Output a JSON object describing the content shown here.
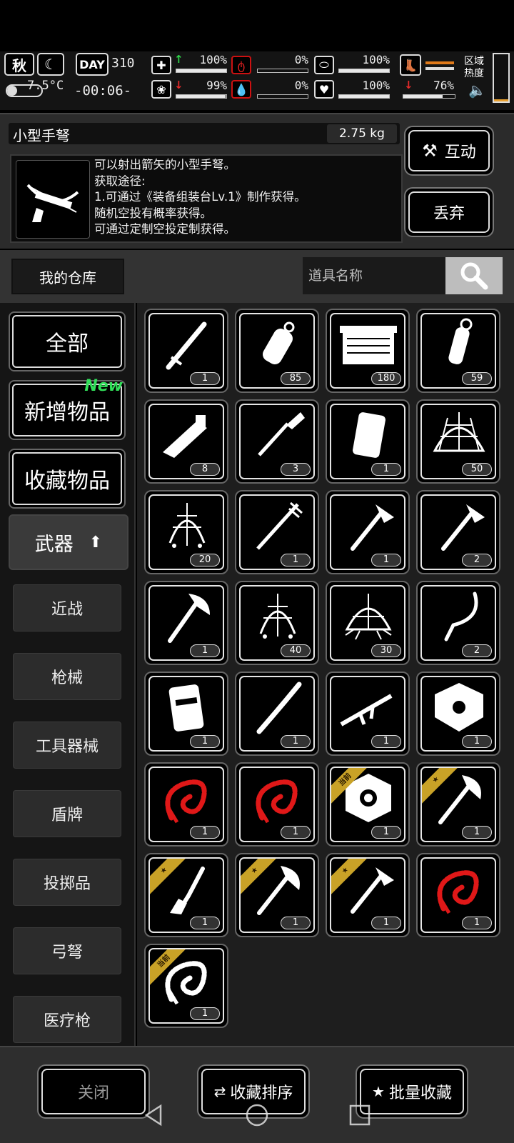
{
  "hud": {
    "season": "秋",
    "temperature": "7.5°C",
    "day_label": "DAY",
    "day_number": "310",
    "clock": "-00:06-",
    "stats": [
      {
        "icon": "medkit-icon",
        "trend": "up",
        "value": "100%",
        "level": 1.0
      },
      {
        "icon": "stomach-icon",
        "trend": "none",
        "value": "0%",
        "level": 0.0
      },
      {
        "icon": "capsule-icon",
        "trend": "none",
        "value": "100%",
        "level": 1.0
      },
      {
        "icon": "brain-icon",
        "trend": "down",
        "value": "99%",
        "level": 0.99
      },
      {
        "icon": "blood-drop-icon",
        "trend": "none",
        "value": "0%",
        "level": 0.0
      },
      {
        "icon": "heart-icon",
        "trend": "none",
        "value": "100%",
        "level": 1.0
      }
    ],
    "stamina": {
      "icon": "boot-icon",
      "trend": "down",
      "value": "76%",
      "level": 0.76
    },
    "zone_label": "区域\n热度",
    "zone_heat_level": 0.05
  },
  "detail": {
    "item_name": "小型手弩",
    "weight": "2.75 kg",
    "description": [
      "可以射出箭矢的小型手弩。",
      "获取途径:",
      "1.可通过《装备组装台Lv.1》制作获得。",
      "随机空投有概率获得。",
      "可通过定制空投定制获得。"
    ],
    "interact_label": "互动",
    "discard_label": "丢弃"
  },
  "warehouse": {
    "tab_label": "我的仓库",
    "search_placeholder": "道具名称"
  },
  "categories": {
    "all": "全部",
    "new_items": "新增物品",
    "new_badge": "New",
    "favorites": "收藏物品",
    "weapons": "武器",
    "subcategories": [
      "近战",
      "枪械",
      "工具器械",
      "盾牌",
      "投掷品",
      "弓弩",
      "医疗枪"
    ]
  },
  "items": [
    {
      "icon": "baton-icon",
      "count": "1"
    },
    {
      "icon": "frag-grenade-icon",
      "count": "85"
    },
    {
      "icon": "ammo-crate-icon",
      "count": "180"
    },
    {
      "icon": "stun-grenade-icon",
      "count": "59"
    },
    {
      "icon": "multi-tool-icon",
      "count": "8"
    },
    {
      "icon": "shovel-icon",
      "count": "3"
    },
    {
      "icon": "armor-plate-icon",
      "count": "1"
    },
    {
      "icon": "net-dome-icon",
      "count": "50"
    },
    {
      "icon": "throw-net-icon",
      "count": "20"
    },
    {
      "icon": "spiked-staff-icon",
      "count": "1"
    },
    {
      "icon": "hatchet-icon",
      "count": "1"
    },
    {
      "icon": "hatchet-icon",
      "count": "2"
    },
    {
      "icon": "battle-axe-icon",
      "count": "1"
    },
    {
      "icon": "throw-net-icon",
      "count": "40"
    },
    {
      "icon": "spider-net-icon",
      "count": "30"
    },
    {
      "icon": "sickle-icon",
      "count": "2"
    },
    {
      "icon": "riot-shield-icon",
      "count": "1"
    },
    {
      "icon": "wooden-club-icon",
      "count": "1"
    },
    {
      "icon": "assault-rifle-icon",
      "count": "1"
    },
    {
      "icon": "round-shield-icon",
      "count": "1"
    },
    {
      "icon": "red-chain-whip-icon",
      "count": "1"
    },
    {
      "icon": "red-chain-whip-icon",
      "count": "1"
    },
    {
      "icon": "hex-shield-icon",
      "count": "1",
      "ribbon": "当前"
    },
    {
      "icon": "axe-icon",
      "count": "1",
      "ribbon": "★"
    },
    {
      "icon": "chisel-icon",
      "count": "1",
      "ribbon": "★"
    },
    {
      "icon": "axe-icon",
      "count": "1",
      "ribbon": "★"
    },
    {
      "icon": "hatchet-icon",
      "count": "1",
      "ribbon": "★"
    },
    {
      "icon": "red-chain-whip-icon",
      "count": "1"
    },
    {
      "icon": "bone-whip-icon",
      "count": "1",
      "ribbon": "当前"
    }
  ],
  "bottom": {
    "close_label": "关闭",
    "sort_label": "收藏排序",
    "batch_label": "批量收藏"
  },
  "colors": {
    "background": "#000000",
    "panel": "#2b2b2b",
    "accent_green": "#32e05a",
    "accent_red": "#e42a2a",
    "ribbon_gold": "#c9a227"
  }
}
